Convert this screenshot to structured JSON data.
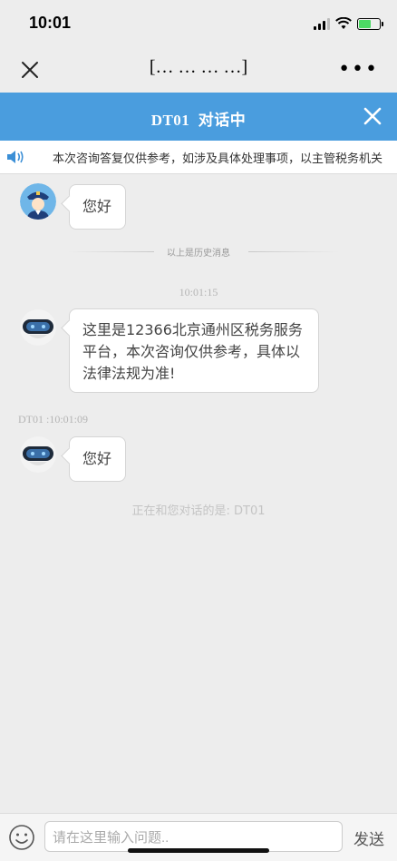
{
  "status_bar": {
    "time": "10:01"
  },
  "nav": {
    "title": "[… … … …]",
    "more": "•••"
  },
  "chat_header": {
    "title": "DT01  对话中"
  },
  "notice": {
    "text": "本次咨询答复仅供参考，如涉及具体处理事项，以主管税务机关"
  },
  "messages": {
    "history_greeting": "您好",
    "history_divider": "以上是历史消息",
    "ts1": "10:01:15",
    "bot_intro": "这里是12366北京通州区税务服务平台，本次咨询仅供参考，具体以法律法规为准!",
    "ts2": "DT01 :10:01:09",
    "bot_greeting": "您好",
    "agent_info": "正在和您对话的是: DT01"
  },
  "input": {
    "placeholder": "请在这里输入问题..",
    "send_label": "发送"
  },
  "colors": {
    "header": "#4a9dde",
    "background": "#ededed"
  }
}
